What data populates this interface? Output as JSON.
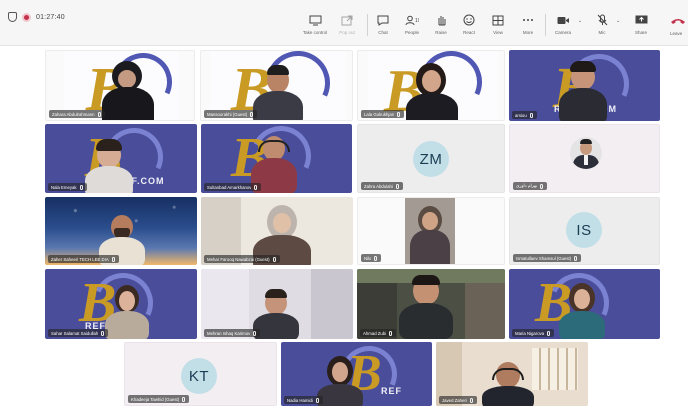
{
  "header": {
    "timer": "01:27:40"
  },
  "toolbar": {
    "buttons": [
      {
        "label": "Take control",
        "icon": "screen-share-control-icon"
      },
      {
        "label": "Pop out",
        "icon": "pop-out-icon"
      },
      {
        "label": "Chat",
        "icon": "chat-icon"
      },
      {
        "label": "People",
        "icon": "people-icon",
        "count": "19"
      },
      {
        "label": "Raise",
        "icon": "raise-hand-icon"
      },
      {
        "label": "React",
        "icon": "react-icon"
      },
      {
        "label": "View",
        "icon": "view-icon"
      },
      {
        "label": "More",
        "icon": "more-icon"
      },
      {
        "label": "Camera",
        "icon": "camera-icon"
      },
      {
        "label": "Mic",
        "icon": "mic-off-icon"
      },
      {
        "label": "Share",
        "icon": "share-icon"
      },
      {
        "label": "Leave",
        "icon": "leave-icon"
      }
    ]
  },
  "colors": {
    "brand_purple": "#4a4e9a",
    "logo_gold": "#c99b24",
    "record_red": "#c4314b",
    "avatar_bg": "#c2dfe8"
  },
  "tiles": [
    {
      "name": "Zahara Abdulrahmann",
      "type": "video"
    },
    {
      "name": "Mansoorakhi (Guest)",
      "type": "video"
    },
    {
      "name": "Lala Gulrukhjan",
      "type": "video"
    },
    {
      "name": "arsiou",
      "type": "video",
      "banner": "REFCS.COM"
    },
    {
      "name": "Nala Emeyak",
      "type": "video",
      "banner": "REF.COM"
    },
    {
      "name": "Sultanbad Amarkhanov",
      "type": "video"
    },
    {
      "name": "Zahra Abdulahi",
      "type": "avatar",
      "initials": "ZM"
    },
    {
      "name": "بهرام داوری",
      "type": "photo"
    },
    {
      "name": "Zaher Saheeri TECH LEE DIA",
      "type": "video"
    },
    {
      "name": "Mehar Farooq Nawabzai (Guest)",
      "type": "video"
    },
    {
      "name": "Nilo",
      "type": "video"
    },
    {
      "name": "Ismatullaev Shamsul (Guest)",
      "type": "avatar",
      "initials": "IS"
    },
    {
      "name": "Sahar Salamat Saidullah",
      "type": "video",
      "banner": "REFCS"
    },
    {
      "name": "Mehran Ishaq Karimov",
      "type": "video"
    },
    {
      "name": "Ahmad Zubi",
      "type": "video"
    },
    {
      "name": "Maria Nigarova",
      "type": "video"
    },
    {
      "name": "Khadeeja Tawhid (Guest)",
      "type": "avatar",
      "initials": "KT"
    },
    {
      "name": "Nadia Hamidi",
      "type": "video",
      "banner": "REF"
    },
    {
      "name": "Javed Zaheri",
      "type": "video"
    }
  ]
}
